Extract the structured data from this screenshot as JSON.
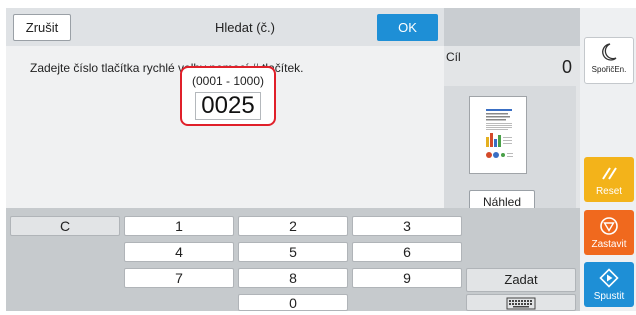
{
  "header": {
    "cancel_label": "Zrušit",
    "title": "Hledat (č.)",
    "ok_label": "OK"
  },
  "message": {
    "instruction": "Zadejte číslo tlačítka rychlé volby pomocí # tlačítek.",
    "range": "(0001 - 1000)",
    "value": "0025"
  },
  "preview": {
    "cil_label": "Cíl",
    "cil_value": "0",
    "preview_label": "Náhled"
  },
  "keypad": {
    "clear": "C",
    "keys": [
      "1",
      "2",
      "3",
      "4",
      "5",
      "6",
      "7",
      "8",
      "9",
      "0"
    ],
    "enter_label": "Zadat"
  },
  "side": {
    "sleep_label": "SpořičEn.",
    "reset_label": "Reset",
    "stop_label": "Zastavit",
    "start_label": "Spustit",
    "colors": {
      "reset": "#f3b31a",
      "stop": "#f0691e",
      "start": "#1e8fd6"
    }
  }
}
